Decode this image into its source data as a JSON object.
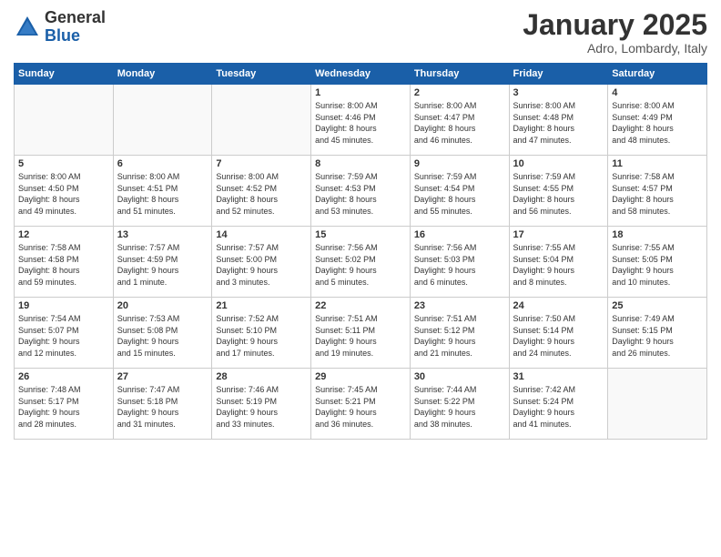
{
  "header": {
    "logo_general": "General",
    "logo_blue": "Blue",
    "month": "January 2025",
    "location": "Adro, Lombardy, Italy"
  },
  "days_of_week": [
    "Sunday",
    "Monday",
    "Tuesday",
    "Wednesday",
    "Thursday",
    "Friday",
    "Saturday"
  ],
  "weeks": [
    [
      {
        "day": "",
        "text": ""
      },
      {
        "day": "",
        "text": ""
      },
      {
        "day": "",
        "text": ""
      },
      {
        "day": "1",
        "text": "Sunrise: 8:00 AM\nSunset: 4:46 PM\nDaylight: 8 hours\nand 45 minutes."
      },
      {
        "day": "2",
        "text": "Sunrise: 8:00 AM\nSunset: 4:47 PM\nDaylight: 8 hours\nand 46 minutes."
      },
      {
        "day": "3",
        "text": "Sunrise: 8:00 AM\nSunset: 4:48 PM\nDaylight: 8 hours\nand 47 minutes."
      },
      {
        "day": "4",
        "text": "Sunrise: 8:00 AM\nSunset: 4:49 PM\nDaylight: 8 hours\nand 48 minutes."
      }
    ],
    [
      {
        "day": "5",
        "text": "Sunrise: 8:00 AM\nSunset: 4:50 PM\nDaylight: 8 hours\nand 49 minutes."
      },
      {
        "day": "6",
        "text": "Sunrise: 8:00 AM\nSunset: 4:51 PM\nDaylight: 8 hours\nand 51 minutes."
      },
      {
        "day": "7",
        "text": "Sunrise: 8:00 AM\nSunset: 4:52 PM\nDaylight: 8 hours\nand 52 minutes."
      },
      {
        "day": "8",
        "text": "Sunrise: 7:59 AM\nSunset: 4:53 PM\nDaylight: 8 hours\nand 53 minutes."
      },
      {
        "day": "9",
        "text": "Sunrise: 7:59 AM\nSunset: 4:54 PM\nDaylight: 8 hours\nand 55 minutes."
      },
      {
        "day": "10",
        "text": "Sunrise: 7:59 AM\nSunset: 4:55 PM\nDaylight: 8 hours\nand 56 minutes."
      },
      {
        "day": "11",
        "text": "Sunrise: 7:58 AM\nSunset: 4:57 PM\nDaylight: 8 hours\nand 58 minutes."
      }
    ],
    [
      {
        "day": "12",
        "text": "Sunrise: 7:58 AM\nSunset: 4:58 PM\nDaylight: 8 hours\nand 59 minutes."
      },
      {
        "day": "13",
        "text": "Sunrise: 7:57 AM\nSunset: 4:59 PM\nDaylight: 9 hours\nand 1 minute."
      },
      {
        "day": "14",
        "text": "Sunrise: 7:57 AM\nSunset: 5:00 PM\nDaylight: 9 hours\nand 3 minutes."
      },
      {
        "day": "15",
        "text": "Sunrise: 7:56 AM\nSunset: 5:02 PM\nDaylight: 9 hours\nand 5 minutes."
      },
      {
        "day": "16",
        "text": "Sunrise: 7:56 AM\nSunset: 5:03 PM\nDaylight: 9 hours\nand 6 minutes."
      },
      {
        "day": "17",
        "text": "Sunrise: 7:55 AM\nSunset: 5:04 PM\nDaylight: 9 hours\nand 8 minutes."
      },
      {
        "day": "18",
        "text": "Sunrise: 7:55 AM\nSunset: 5:05 PM\nDaylight: 9 hours\nand 10 minutes."
      }
    ],
    [
      {
        "day": "19",
        "text": "Sunrise: 7:54 AM\nSunset: 5:07 PM\nDaylight: 9 hours\nand 12 minutes."
      },
      {
        "day": "20",
        "text": "Sunrise: 7:53 AM\nSunset: 5:08 PM\nDaylight: 9 hours\nand 15 minutes."
      },
      {
        "day": "21",
        "text": "Sunrise: 7:52 AM\nSunset: 5:10 PM\nDaylight: 9 hours\nand 17 minutes."
      },
      {
        "day": "22",
        "text": "Sunrise: 7:51 AM\nSunset: 5:11 PM\nDaylight: 9 hours\nand 19 minutes."
      },
      {
        "day": "23",
        "text": "Sunrise: 7:51 AM\nSunset: 5:12 PM\nDaylight: 9 hours\nand 21 minutes."
      },
      {
        "day": "24",
        "text": "Sunrise: 7:50 AM\nSunset: 5:14 PM\nDaylight: 9 hours\nand 24 minutes."
      },
      {
        "day": "25",
        "text": "Sunrise: 7:49 AM\nSunset: 5:15 PM\nDaylight: 9 hours\nand 26 minutes."
      }
    ],
    [
      {
        "day": "26",
        "text": "Sunrise: 7:48 AM\nSunset: 5:17 PM\nDaylight: 9 hours\nand 28 minutes."
      },
      {
        "day": "27",
        "text": "Sunrise: 7:47 AM\nSunset: 5:18 PM\nDaylight: 9 hours\nand 31 minutes."
      },
      {
        "day": "28",
        "text": "Sunrise: 7:46 AM\nSunset: 5:19 PM\nDaylight: 9 hours\nand 33 minutes."
      },
      {
        "day": "29",
        "text": "Sunrise: 7:45 AM\nSunset: 5:21 PM\nDaylight: 9 hours\nand 36 minutes."
      },
      {
        "day": "30",
        "text": "Sunrise: 7:44 AM\nSunset: 5:22 PM\nDaylight: 9 hours\nand 38 minutes."
      },
      {
        "day": "31",
        "text": "Sunrise: 7:42 AM\nSunset: 5:24 PM\nDaylight: 9 hours\nand 41 minutes."
      },
      {
        "day": "",
        "text": ""
      }
    ]
  ]
}
